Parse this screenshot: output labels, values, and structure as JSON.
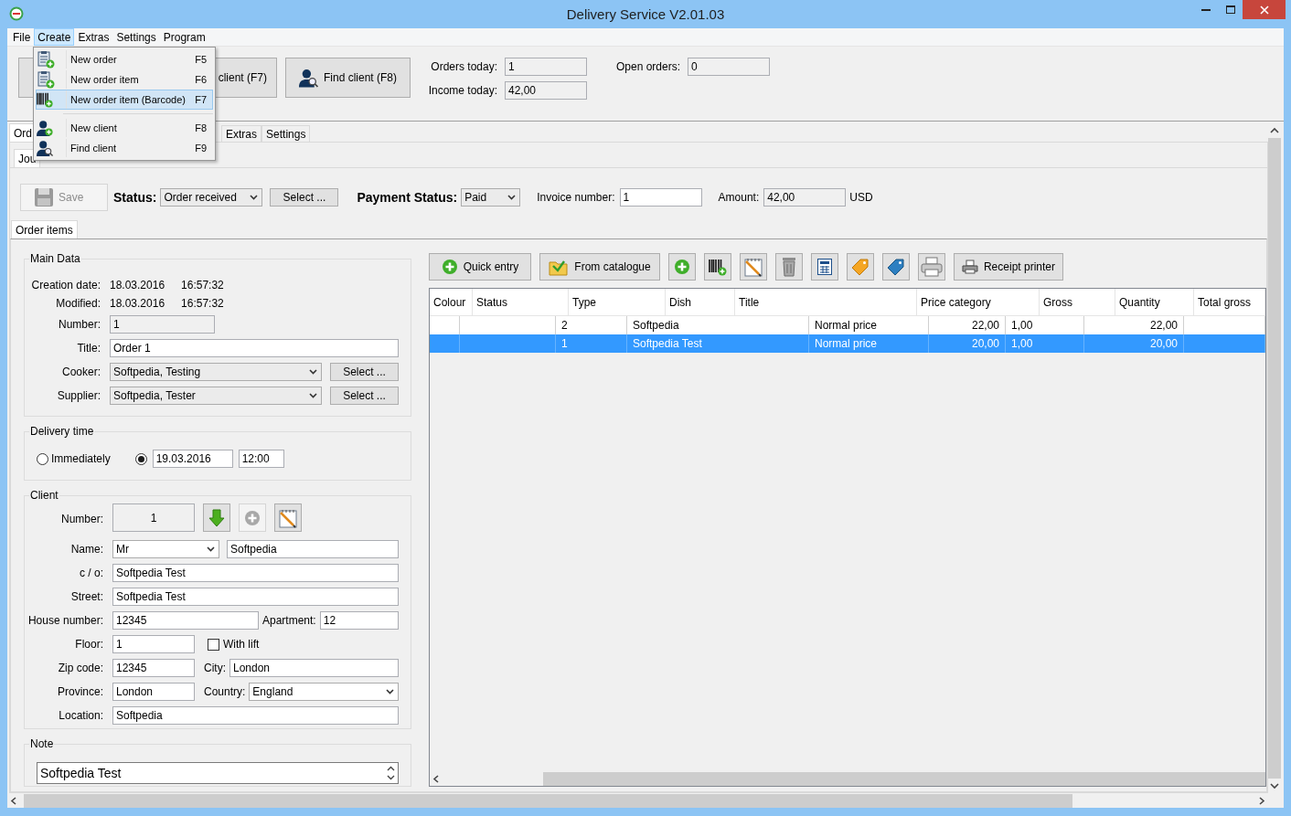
{
  "window": {
    "title": "Delivery Service V2.01.03"
  },
  "menu_bar": [
    {
      "label": "File",
      "selected": false
    },
    {
      "label": "Create",
      "selected": true
    },
    {
      "label": "Extras",
      "selected": false
    },
    {
      "label": "Settings",
      "selected": false
    },
    {
      "label": "Program",
      "selected": false
    }
  ],
  "create_menu": [
    {
      "kind": "order",
      "label": "New order",
      "shortcut": "F5",
      "selected": false
    },
    {
      "kind": "order",
      "label": "New order item",
      "shortcut": "F6",
      "selected": false
    },
    {
      "kind": "barcode",
      "label": "New order item (Barcode)",
      "shortcut": "F7",
      "selected": true
    },
    {
      "kind": "separator"
    },
    {
      "kind": "client",
      "label": "New client",
      "shortcut": "F8",
      "selected": false
    },
    {
      "kind": "find",
      "label": "Find client",
      "shortcut": "F9",
      "selected": false
    }
  ],
  "toolbar": {
    "new_client": "client (F7)",
    "find_client": "Find client (F8)"
  },
  "stats": {
    "orders_today_label": "Orders today:",
    "orders_today": "1",
    "income_today_label": "Income today:",
    "income_today": "42,00",
    "open_orders_label": "Open orders:",
    "open_orders": "0"
  },
  "main_tabs": [
    {
      "label": "Ord",
      "selected": true
    },
    {
      "label": "Extras",
      "selected": false
    },
    {
      "label": "Settings",
      "selected": false
    }
  ],
  "sub_tabs": [
    {
      "label": "Jou",
      "selected": true
    }
  ],
  "order_bar": {
    "save": "Save",
    "save_disabled": true,
    "status_label": "Status:",
    "status": "Order received",
    "status_select": "Select ...",
    "payment_label": "Payment Status:",
    "payment": "Paid",
    "invoice_label": "Invoice number:",
    "invoice": "1",
    "amount_label": "Amount:",
    "amount": "42,00",
    "currency": "USD"
  },
  "detail_tabs": [
    {
      "label": "Order items",
      "selected": true
    }
  ],
  "main_data": {
    "title": "Main Data",
    "creation_label": "Creation date:",
    "creation_date": "18.03.2016",
    "creation_time": "16:57:32",
    "modified_label": "Modified:",
    "modified_date": "18.03.2016",
    "modified_time": "16:57:32",
    "number_label": "Number:",
    "number": "1",
    "title_label": "Title:",
    "title_value": "Order 1",
    "cooker_label": "Cooker:",
    "cooker": "Softpedia, Testing",
    "cooker_select": "Select ...",
    "supplier_label": "Supplier:",
    "supplier": "Softpedia, Tester",
    "supplier_select": "Select ..."
  },
  "delivery_time": {
    "title": "Delivery time",
    "immediately": {
      "label": "Immediately",
      "selected": false
    },
    "scheduled": {
      "selected": true
    },
    "date": "19.03.2016",
    "time": "12:00"
  },
  "client": {
    "title": "Client",
    "number_label": "Number:",
    "number": "1",
    "name_label": "Name:",
    "salutation": "Mr",
    "name": "Softpedia",
    "co_label": "c / o:",
    "co": "Softpedia Test",
    "street_label": "Street:",
    "street": "Softpedia Test",
    "house_label": "House number:",
    "house": "12345",
    "apartment_label": "Apartment:",
    "apartment": "12",
    "floor_label": "Floor:",
    "floor": "1",
    "lift": {
      "label": "With lift",
      "checked": false
    },
    "zip_label": "Zip code:",
    "zip": "12345",
    "city_label": "City:",
    "city": "London",
    "province_label": "Province:",
    "province": "London",
    "country_label": "Country:",
    "country": "England",
    "location_label": "Location:",
    "location": "Softpedia"
  },
  "note": {
    "title": "Note",
    "value": "Softpedia Test"
  },
  "items_toolbar": {
    "quick_entry": "Quick entry",
    "from_catalogue": "From catalogue",
    "receipt_printer": "Receipt printer"
  },
  "items_table": {
    "columns": [
      "Colour",
      "Status",
      "Type",
      "Dish",
      "Title",
      "Price category",
      "Gross",
      "Quantity",
      "Total gross"
    ],
    "rows": [
      {
        "selected": false,
        "cells": [
          "",
          "",
          "2",
          "Softpedia",
          "Normal price",
          "22,00",
          "1,00",
          "22,00",
          ""
        ]
      },
      {
        "selected": true,
        "cells": [
          "",
          "",
          "1",
          "Softpedia Test",
          "Normal price",
          "20,00",
          "1,00",
          "20,00",
          ""
        ]
      }
    ]
  }
}
